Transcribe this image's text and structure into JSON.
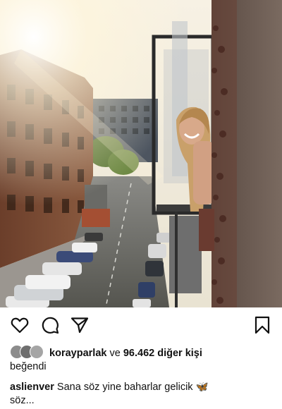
{
  "post": {
    "image_alt": "Smiling woman leaning out of an apartment window above a sunlit street with parked cars"
  },
  "actions": {
    "like_icon": "heart-icon",
    "comment_icon": "comment-icon",
    "share_icon": "share-icon",
    "save_icon": "bookmark-icon"
  },
  "likes": {
    "username": "korayparlak",
    "connector": "ve",
    "count": "96.462",
    "others": "diğer kişi",
    "verb": "beğendi"
  },
  "caption": {
    "username": "aslienver",
    "text": "Sana söz yine baharlar gelicik",
    "emoji": "🦋",
    "text_cont": "söz..."
  }
}
